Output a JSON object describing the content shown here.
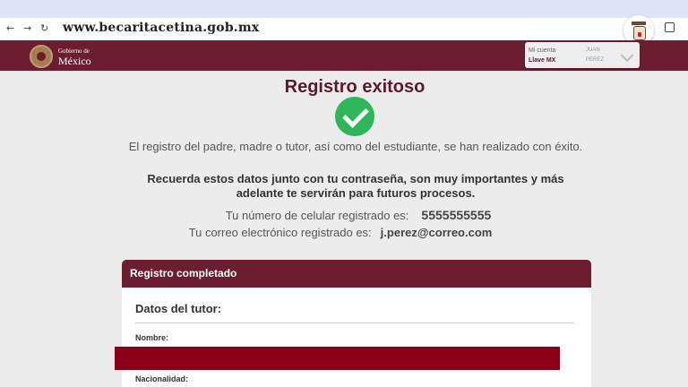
{
  "browser": {
    "url": "www.becaritacetina.gob.mx",
    "back_icon": "arrow-left-icon",
    "forward_icon": "arrow-right-icon",
    "reload_icon": "reload-icon",
    "extension_icon": "graduate-avatar-icon",
    "extensions_menu_icon": "puzzle-icon",
    "back_glyph": "←",
    "forward_glyph": "→",
    "reload_glyph": "↻"
  },
  "header": {
    "logo_small": "Gobierno de",
    "logo_big": "México",
    "account_label": "Mi cuenta",
    "account_title": "Llave MX",
    "user_first": "JUAN",
    "user_last": "PEREZ",
    "brand_color": "#6b1d31"
  },
  "main": {
    "title": "Registro exitoso",
    "success_color": "#2fb55a",
    "info1": "El registro del padre, madre o tutor, así como del estudiante, se han realizado con éxito.",
    "info2": "Recuerda estos datos junto con tu contraseña, son muy importantes y más adelante te servirán para futuros procesos.",
    "phone_label": "Tu número de celular registrado es:",
    "phone_value": "5555555555",
    "email_label": "Tu correo electrónico registrado es:",
    "email_value": "j.perez@correo.com"
  },
  "card": {
    "header": "Registro completado",
    "section_title": "Datos del tutor:",
    "field_nombre": "Nombre:",
    "field_nacionalidad": "Nacionalidad:",
    "redaction_color": "#8b0016"
  }
}
